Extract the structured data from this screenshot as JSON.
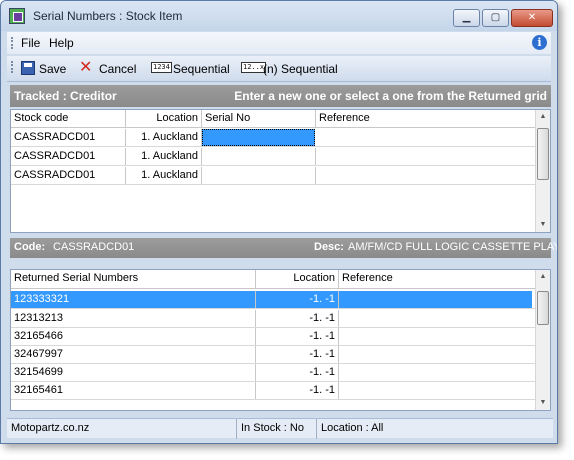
{
  "window": {
    "title": "Serial Numbers : Stock Item"
  },
  "menu": {
    "items": [
      "File",
      "Help"
    ]
  },
  "toolbar": {
    "save_label": "Save",
    "cancel_label": "Cancel",
    "sequential_label": "Sequential",
    "sequential_icon_text": "1234",
    "n_sequential_label": "(n) Sequential",
    "n_sequential_icon_text": "12..x"
  },
  "tracked_header": {
    "left": "Tracked : Creditor",
    "right": "Enter a new one or select a one from the Returned grid"
  },
  "tracked_grid": {
    "columns": [
      "Stock code",
      "Location",
      "Serial No",
      "Reference"
    ],
    "rows": [
      {
        "stock_code": "CASSRADCD01",
        "location": "1. Auckland",
        "serial_no": "",
        "reference": ""
      },
      {
        "stock_code": "CASSRADCD01",
        "location": "1. Auckland",
        "serial_no": "",
        "reference": ""
      },
      {
        "stock_code": "CASSRADCD01",
        "location": "1. Auckland",
        "serial_no": "",
        "reference": ""
      }
    ]
  },
  "desc_bar": {
    "code_label": "Code:",
    "code_value": "CASSRADCD01",
    "desc_label": "Desc:",
    "desc_value": "AM/FM/CD FULL LOGIC CASSETTE PLAY"
  },
  "returned_grid": {
    "columns": [
      "Returned Serial Numbers",
      "Location",
      "Reference"
    ],
    "rows": [
      {
        "serial": "123333321",
        "location": "-1. -1",
        "reference": ""
      },
      {
        "serial": "12313213",
        "location": "-1. -1",
        "reference": ""
      },
      {
        "serial": "32165466",
        "location": "-1. -1",
        "reference": ""
      },
      {
        "serial": "32467997",
        "location": "-1. -1",
        "reference": ""
      },
      {
        "serial": "32154699",
        "location": "-1. -1",
        "reference": ""
      },
      {
        "serial": "32165461",
        "location": "-1. -1",
        "reference": ""
      }
    ]
  },
  "status": {
    "company": "Motopartz.co.nz",
    "in_stock": "In Stock : No",
    "location": "Location : All"
  },
  "colors": {
    "selection": "#3399ff",
    "header_gray": "#8a8a8a",
    "window_frame": "#cfdcec"
  },
  "icons": [
    "app-icon",
    "info-icon",
    "save-icon",
    "cancel-icon",
    "sequential-icon",
    "n-sequential-icon"
  ]
}
